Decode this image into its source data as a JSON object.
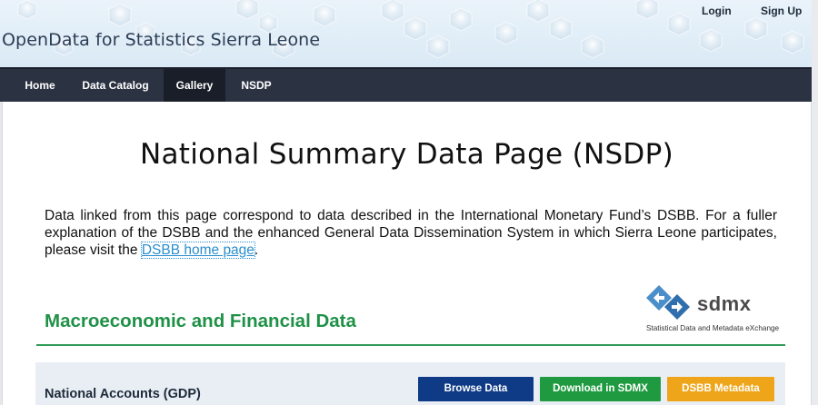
{
  "header": {
    "site_title": "OpenData for Statistics Sierra Leone",
    "login_label": "Login",
    "signup_label": "Sign Up"
  },
  "nav": {
    "items": [
      {
        "label": "Home"
      },
      {
        "label": "Data Catalog"
      },
      {
        "label": "Gallery",
        "active": true
      },
      {
        "label": "NSDP"
      }
    ]
  },
  "main": {
    "page_title": "National Summary Data Page (NSDP)",
    "intro_text": "Data linked from this page correspond to data described in the International Monetary Fund’s DSBB. For a fuller explanation of the DSBB and the enhanced General Data Dissemination System in which Sierra Leone participates, please visit the ",
    "intro_link": "DSBB home page",
    "intro_end": ".",
    "section_title": "Macroeconomic and Financial Data",
    "logo": {
      "word": "sdmx",
      "tagline": "Statistical Data and Metadata eXchange"
    },
    "datasets": [
      {
        "name": "National Accounts (GDP)",
        "browse_label": "Browse Data",
        "sdmx_label": "Download in SDMX",
        "meta_label": "DSBB Metadata"
      }
    ]
  },
  "colors": {
    "nav_bg": "#2b3242",
    "section_green": "#1f9147",
    "browse_blue": "#0f3a86",
    "sdmx_green": "#1f9a40",
    "meta_orange": "#eea519",
    "link_blue": "#2a8ecf"
  },
  "icons": {
    "logo": "sdmx-logo-icon",
    "header_background": "hexagon-pattern"
  }
}
